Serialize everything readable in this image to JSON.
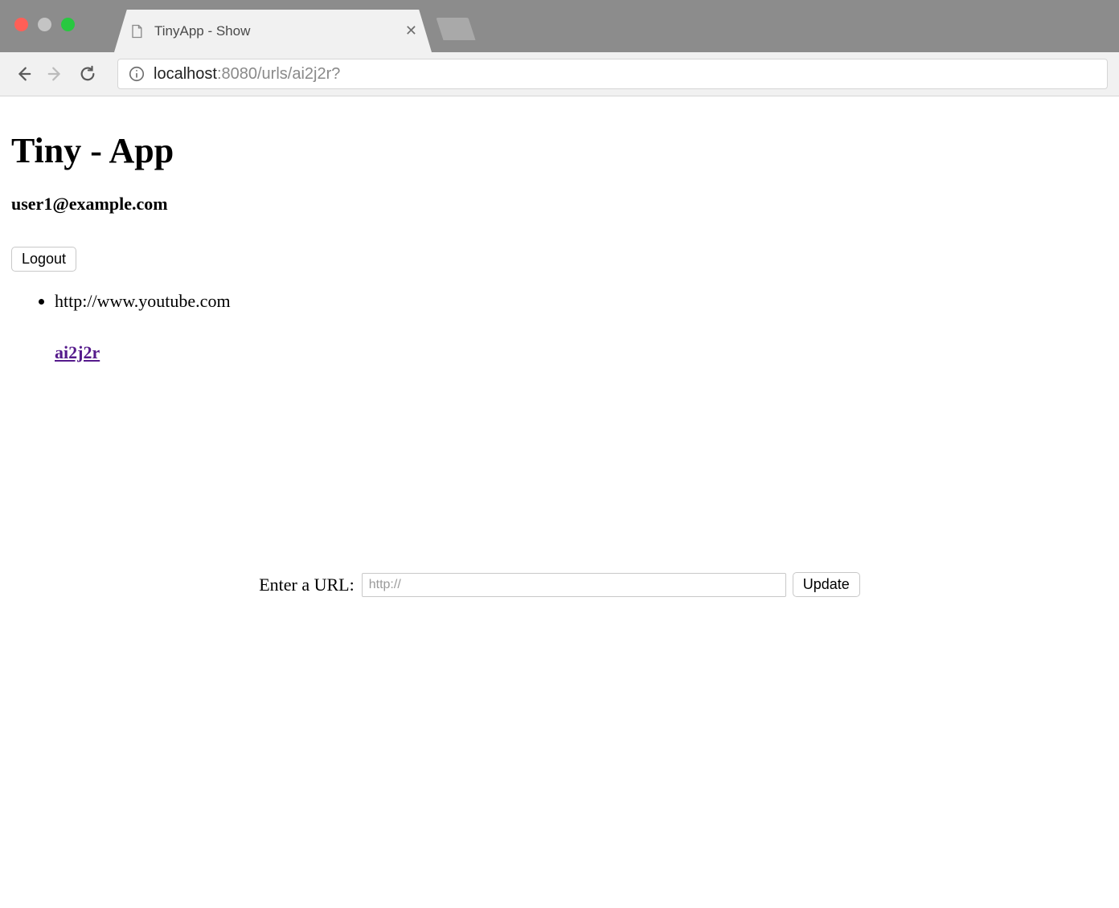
{
  "browser": {
    "tab_title": "TinyApp - Show",
    "url": {
      "host": "localhost",
      "path": ":8080/urls/ai2j2r?"
    }
  },
  "content": {
    "app_title": "Tiny - App",
    "user_email": "user1@example.com",
    "logout_label": "Logout",
    "url_item": {
      "long_url": "http://www.youtube.com",
      "short_code": "ai2j2r"
    },
    "form": {
      "label": "Enter a URL: ",
      "placeholder": "http://",
      "submit_label": "Update"
    }
  }
}
